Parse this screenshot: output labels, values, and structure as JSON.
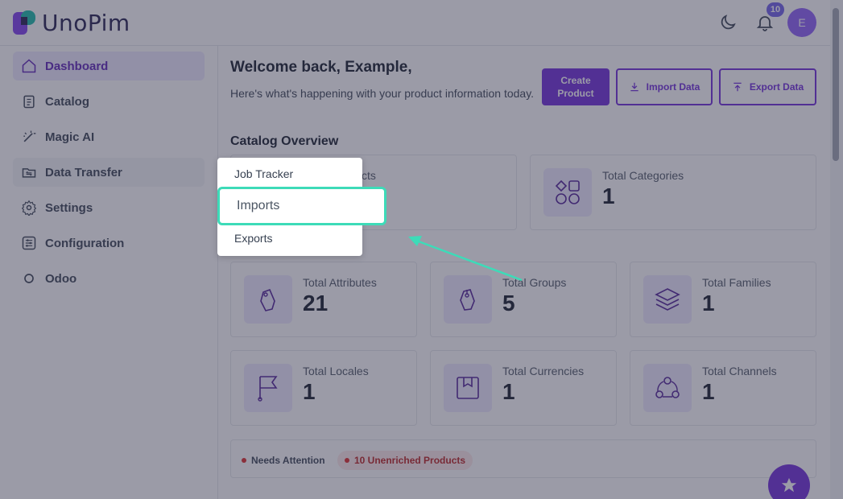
{
  "header": {
    "logo_text": "UnoPim",
    "notification_count": "10",
    "avatar_initial": "E"
  },
  "sidebar": {
    "items": [
      {
        "label": "Dashboard",
        "icon": "home-icon"
      },
      {
        "label": "Catalog",
        "icon": "clipboard-icon"
      },
      {
        "label": "Magic AI",
        "icon": "magic-wand-icon"
      },
      {
        "label": "Data Transfer",
        "icon": "data-transfer-icon"
      },
      {
        "label": "Settings",
        "icon": "gear-icon"
      },
      {
        "label": "Configuration",
        "icon": "sliders-icon"
      },
      {
        "label": "Odoo",
        "icon": "circle-icon"
      }
    ]
  },
  "main": {
    "welcome": "Welcome back, Example,",
    "subtitle": "Here's what's happening with your product information today.",
    "buttons": {
      "create_product": "Create Product",
      "import_data": "Import Data",
      "export_data": "Export Data"
    },
    "catalog_overview": "Catalog Overview",
    "partial_label": "cts",
    "cards": [
      {
        "label": "Total Categories",
        "value": "1",
        "icon": "shapes-icon"
      },
      {
        "label": "Total Attributes",
        "value": "21",
        "icon": "tag-icon"
      },
      {
        "label": "Total Groups",
        "value": "5",
        "icon": "tag-group-icon"
      },
      {
        "label": "Total Families",
        "value": "1",
        "icon": "layers-icon"
      },
      {
        "label": "Total Locales",
        "value": "1",
        "icon": "flag-icon"
      },
      {
        "label": "Total Currencies",
        "value": "1",
        "icon": "currency-icon"
      },
      {
        "label": "Total Channels",
        "value": "1",
        "icon": "channels-icon"
      }
    ],
    "attention": {
      "needs_attention": "Needs Attention",
      "unenriched": "10 Unenriched Products"
    }
  },
  "flyout": {
    "job_tracker": "Job Tracker",
    "imports": "Imports",
    "exports": "Exports"
  },
  "colors": {
    "accent": "#6d28d9",
    "highlight": "#3ddbb8",
    "overlay": "rgba(55,55,80,0.5)"
  }
}
